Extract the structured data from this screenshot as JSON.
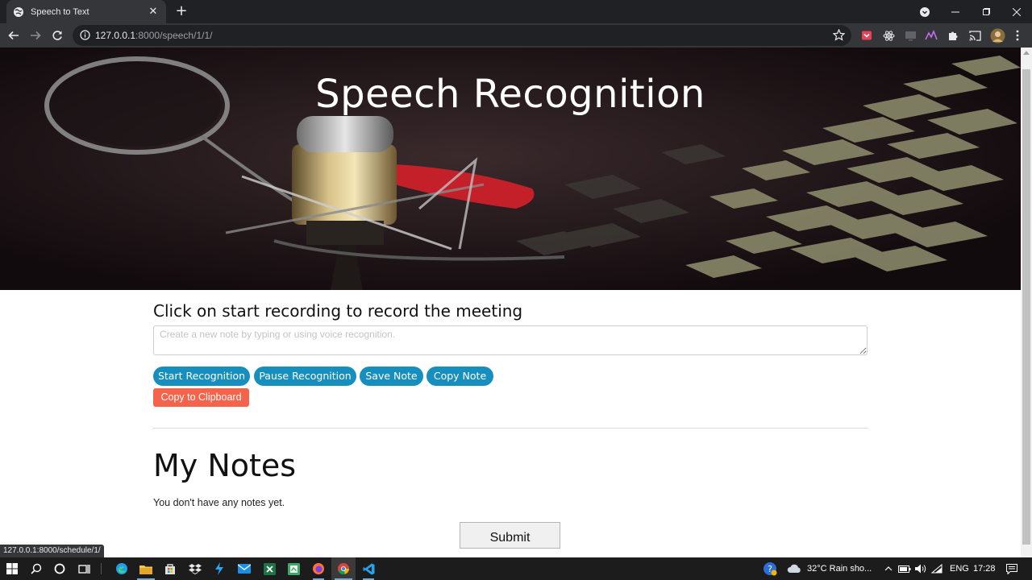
{
  "browser": {
    "tab_title": "Speech to Text",
    "url_host": "127.0.0.1",
    "url_rest": ":8000/speech/1/1/",
    "status_url": "127.0.0.1:8000/schedule/1/"
  },
  "hero": {
    "title": "Speech Recognition"
  },
  "page": {
    "prompt": "Click on start recording to record the meeting",
    "note_placeholder": "Create a new note by typing or using voice recognition.",
    "buttons": {
      "start": "Start Recognition",
      "pause": "Pause Recognition",
      "save": "Save Note",
      "copy": "Copy Note",
      "clipboard": "Copy to Clipboard"
    },
    "notes_title": "My Notes",
    "empty_notes": "You don't have any notes yet.",
    "submit": "Submit"
  },
  "taskbar": {
    "weather": "32°C  Rain sho...",
    "language": "ENG",
    "time": "17:28"
  },
  "colors": {
    "primary_button": "#168fbf",
    "clipboard_button": "#f5634a",
    "browser_chrome": "#35363a"
  },
  "icons": {
    "tab_favicon": "globe-icon",
    "back": "arrow-left-icon",
    "forward": "arrow-right-icon",
    "reload": "reload-icon",
    "bookmark": "star-icon",
    "extensions": "puzzle-icon"
  }
}
